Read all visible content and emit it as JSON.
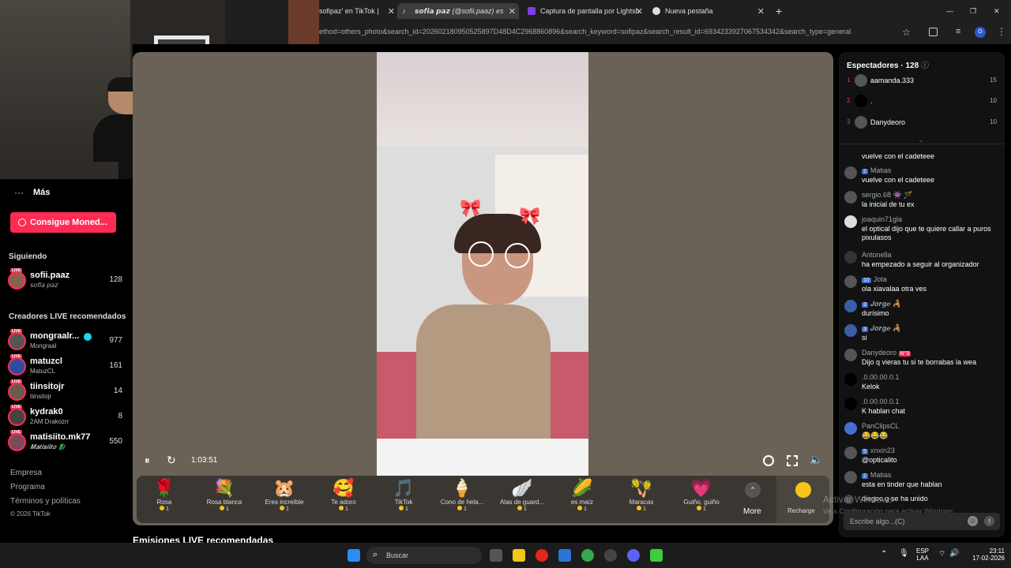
{
  "browser": {
    "tabs": [
      {
        "title": "sofipaz' en TikTok | "
      },
      {
        "title": "𝙨𝙤𝙛𝙞𝙖 𝙥𝙖𝙯 (@sofii.paaz) es"
      },
      {
        "title": "Captura de pantalla por Lightsh"
      },
      {
        "title": "Nueva pestaña"
      }
    ],
    "new_tab": "+",
    "url": "ethod=others_photo&search_id=202602180950525897D48D4C2968860896&search_keyword=sofipaz&search_result_id=6934233927067534342&search_type=general",
    "profile_initial": "O"
  },
  "sidebar": {
    "more_label": "Más",
    "coins_button": "Consigue Moned...",
    "following_title": "Siguiendo",
    "following": [
      {
        "name": "sofii.paaz",
        "sub": "𝘴𝘰𝘧𝘪𝘢 𝘱𝘢𝘻",
        "count": "128"
      }
    ],
    "recommended_title": "Creadores LIVE recomendados",
    "recommended": [
      {
        "name": "mongraalr...",
        "sub": "Mongraal",
        "count": "977"
      },
      {
        "name": "matuzcl",
        "sub": "MatuzCL",
        "count": "161"
      },
      {
        "name": "tiinsitojr",
        "sub": "tiinsitojr",
        "count": "14"
      },
      {
        "name": "kydrak0",
        "sub": "2AM Drakozrr",
        "count": "8"
      },
      {
        "name": "matisiito.mk77",
        "sub": "𝑴𝒂𝒕𝒊𝒔𝒊𝒊𝒕𝒐 🐉",
        "count": "550"
      }
    ],
    "live_badge": "LIVE",
    "footer": [
      "Empresa",
      "Programa",
      "Términos y políticas",
      "© 2026 TikTok"
    ]
  },
  "player": {
    "time": "1:03:51",
    "bottom_heading": "Emisiones LIVE recomendadas"
  },
  "gifts": [
    {
      "name": "Rosa",
      "price": "1",
      "icon": "🌹"
    },
    {
      "name": "Rosa blanca",
      "price": "1",
      "icon": "💐"
    },
    {
      "name": "Eres increíble",
      "price": "1",
      "icon": "🐹"
    },
    {
      "name": "Te adoro",
      "price": "1",
      "icon": "🥰"
    },
    {
      "name": "TikTok",
      "price": "1",
      "icon": "🎵"
    },
    {
      "name": "Cono de hela...",
      "price": "1",
      "icon": "🍦"
    },
    {
      "name": "Alas de guard...",
      "price": "1",
      "icon": "🪽"
    },
    {
      "name": "es maíz",
      "price": "1",
      "icon": "🌽"
    },
    {
      "name": "Maracas",
      "price": "1",
      "icon": "🪇"
    },
    {
      "name": "Guiño, guiño",
      "price": "1",
      "icon": "💗"
    }
  ],
  "gift_more": "More",
  "recharge": "Recharge",
  "chat": {
    "viewers_title": "Espectadores",
    "viewers_count": "128",
    "top_viewers": [
      {
        "rank": "1",
        "name": "aamanda.333",
        "score": "15"
      },
      {
        "rank": "2",
        "name": ".",
        "score": "10"
      },
      {
        "rank": "3",
        "name": "Danydeoro",
        "score": "10"
      }
    ],
    "messages": [
      {
        "user": "",
        "badge": "",
        "text": "vuelve con el cadeteee"
      },
      {
        "user": "Matias",
        "badge": "2",
        "text": "vuelve con el cadeteee"
      },
      {
        "user": "sergio.68 👾 🪄",
        "badge": "",
        "text": "la inicial de tu ex"
      },
      {
        "user": "joaquin71gla",
        "badge": "",
        "text": "el optical dijo que te quiere callar a puros pixulasos"
      },
      {
        "user": "Antonella",
        "badge": "",
        "text": "ha empezado a seguir al organizador"
      },
      {
        "user": "Jota",
        "badge": "10",
        "text": "ola xiavalaa otra ves"
      },
      {
        "user": "𝑱𝒐𝒓𝒈𝒆 🦂",
        "badge": "3",
        "text": "durísimo"
      },
      {
        "user": "𝑱𝒐𝒓𝒈𝒆 🦂",
        "badge": "3",
        "text": "si"
      },
      {
        "user": "Danydeoro",
        "badge": "N°3",
        "text": "Dijo q vieras tu si te borrabas la wea"
      },
      {
        "user": ".0.00.00.0.1",
        "badge": "",
        "text": "Kelok"
      },
      {
        "user": ".0.00.00.0.1",
        "badge": "",
        "text": "K hablan chat"
      },
      {
        "user": "PanClipsCL",
        "badge": "",
        "text": "😂😂😂"
      },
      {
        "user": "xnxin23",
        "badge": "5",
        "text": "@opticalito"
      },
      {
        "user": "Matias",
        "badge": "2",
        "text": "esta en tinder que hablan"
      },
      {
        "user": "diegoo.g",
        "badge": "",
        "text": "se ha unido"
      }
    ],
    "input_placeholder": "Escribe algo...(C)",
    "watermark_line1": "Activar Windows",
    "watermark_line2": "Ve a Configuración para activar Windows."
  },
  "taskbar": {
    "search_placeholder": "Buscar",
    "lang1": "ESP",
    "lang2": "LAA",
    "time": "23:11",
    "date": "17-02-2026"
  },
  "colors": {
    "accent": "#fe2c55",
    "player_bg": "#6b6257",
    "chat_bg": "#121212"
  }
}
